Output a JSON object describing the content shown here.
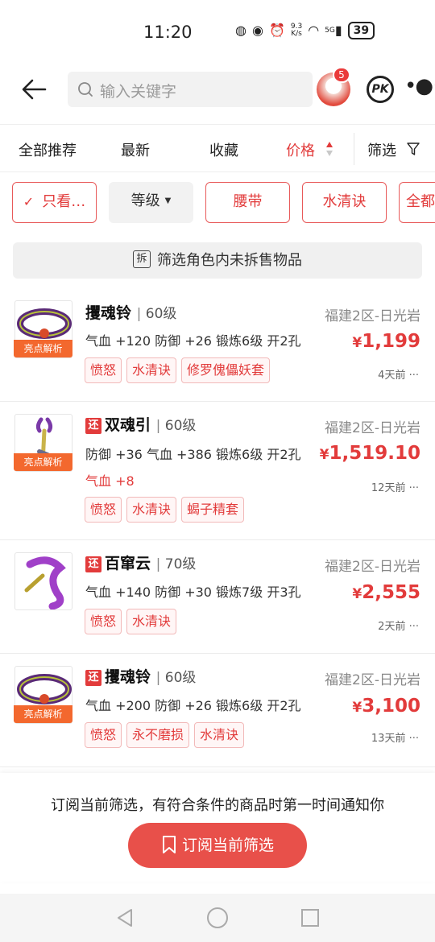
{
  "status_bar": {
    "time": "11:20",
    "network_speed_value": "9.3",
    "network_speed_unit": "K/s",
    "signal_label": "5G",
    "battery": "39"
  },
  "top_bar": {
    "search_placeholder": "输入关键字",
    "notification_count": "5",
    "pk_label": "PK"
  },
  "sort_tabs": {
    "recommend": "全部推荐",
    "latest": "最新",
    "favorites": "收藏",
    "price": "价格",
    "filter": "筛选",
    "active": "price",
    "accent_color": "#e23b3b"
  },
  "chips": [
    {
      "label": "只看…",
      "checked": true
    },
    {
      "label": "等级"
    },
    {
      "label": "腰带"
    },
    {
      "label": "水清诀"
    },
    {
      "label": "全都"
    }
  ],
  "banner": {
    "icon_char": "拆",
    "text": "筛选角色内未拆售物品"
  },
  "items": [
    {
      "name": "攫魂铃",
      "level": "60级",
      "returned": false,
      "server": "福建2区-日光岩",
      "attrs": "气血 +120 防御 +26 锻炼6级 开2孔",
      "extra_attr": "",
      "price_symbol": "¥",
      "price": "1,199",
      "time": "4天前",
      "more": "···",
      "analysis_tag": "亮点解析",
      "tags": [
        "愤怒",
        "水清诀",
        "修罗傀儡妖套"
      ],
      "icon": "ring-icon"
    },
    {
      "name": "双魂引",
      "level": "60级",
      "returned": true,
      "return_label": "还",
      "server": "福建2区-日光岩",
      "attrs": "防御 +36 气血 +386 锻炼6级 开2孔",
      "extra_attr": "气血 +8",
      "price_symbol": "¥",
      "price": "1,519.10",
      "time": "12天前",
      "more": "···",
      "analysis_tag": "亮点解析",
      "tags": [
        "愤怒",
        "水清诀",
        "蝎子精套"
      ],
      "icon": "hook-icon"
    },
    {
      "name": "百窜云",
      "level": "70级",
      "returned": true,
      "return_label": "还",
      "server": "福建2区-日光岩",
      "attrs": "气血 +140 防御 +30 锻炼7级 开3孔",
      "extra_attr": "",
      "price_symbol": "¥",
      "price": "2,555",
      "time": "2天前",
      "more": "···",
      "analysis_tag": "",
      "tags": [
        "愤怒",
        "水清诀"
      ],
      "icon": "sash-icon"
    },
    {
      "name": "攫魂铃",
      "level": "60级",
      "returned": true,
      "return_label": "还",
      "server": "福建2区-日光岩",
      "attrs": "气血 +200 防御 +26 锻炼6级 开2孔",
      "extra_attr": "",
      "price_symbol": "¥",
      "price": "3,100",
      "time": "13天前",
      "more": "···",
      "analysis_tag": "亮点解析",
      "tags": [
        "愤怒",
        "永不磨损",
        "水清诀"
      ],
      "icon": "ring-icon"
    }
  ],
  "subscribe": {
    "text": "订阅当前筛选，有符合条件的商品时第一时间通知你",
    "button_label": "订阅当前筛选",
    "button_color": "#e8504a"
  }
}
